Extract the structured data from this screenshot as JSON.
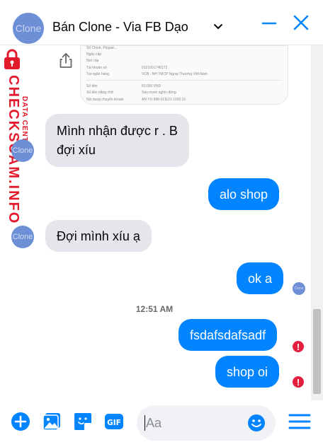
{
  "header": {
    "title": "Bán Clone - Via FB Dạo",
    "avatar_text": "Clone",
    "icons": [
      "chevron-down-icon",
      "minimize-icon",
      "close-icon"
    ],
    "accent_color": "#0084ff"
  },
  "watermark": {
    "line1": "DATA CENTER",
    "line2": "CHECKSCAM.INFO",
    "color": "#e21b2c"
  },
  "receipt": {
    "rows": [
      {
        "label": "Số Clone, Paypal...",
        "value": ""
      },
      {
        "label": "Ngày cấp",
        "value": ""
      },
      {
        "label": "Nơi cấp",
        "value": ""
      },
      {
        "label": "Tài khoản số",
        "value": "0101001748172"
      },
      {
        "label": "Tại ngân hàng",
        "value": "VCB - NH TMCP Ngoại Thương Việt Nam"
      },
      {
        "label": "Số tiền",
        "value": "60.000 VND"
      },
      {
        "label": "Số tiền bằng chữ",
        "value": "Sáu mươi nghìn đồng"
      },
      {
        "label": "Nội dung chuyển khoản",
        "value": "AN YU 998-011121-1920.31"
      }
    ]
  },
  "messages": [
    {
      "side": "in",
      "lines": [
        "Mình nhận được r . B",
        "đợi xíu"
      ]
    },
    {
      "side": "out",
      "text": "alo shop"
    },
    {
      "side": "in",
      "text": "Đợi mình xíu ạ"
    },
    {
      "side": "out",
      "text": "ok a"
    },
    {
      "side": "out",
      "text": "fsdafsdafsadf",
      "error": "!"
    },
    {
      "side": "out",
      "text": "shop oi",
      "error": "!"
    }
  ],
  "timestamp": "12:51 AM",
  "avatar_small_text": "Clone",
  "composer": {
    "placeholder": "Aa",
    "gif_label": "GIF",
    "icons": [
      "add-icon",
      "photo-icon",
      "sticker-icon",
      "gif-icon",
      "emoji-icon",
      "menu-icon"
    ]
  }
}
